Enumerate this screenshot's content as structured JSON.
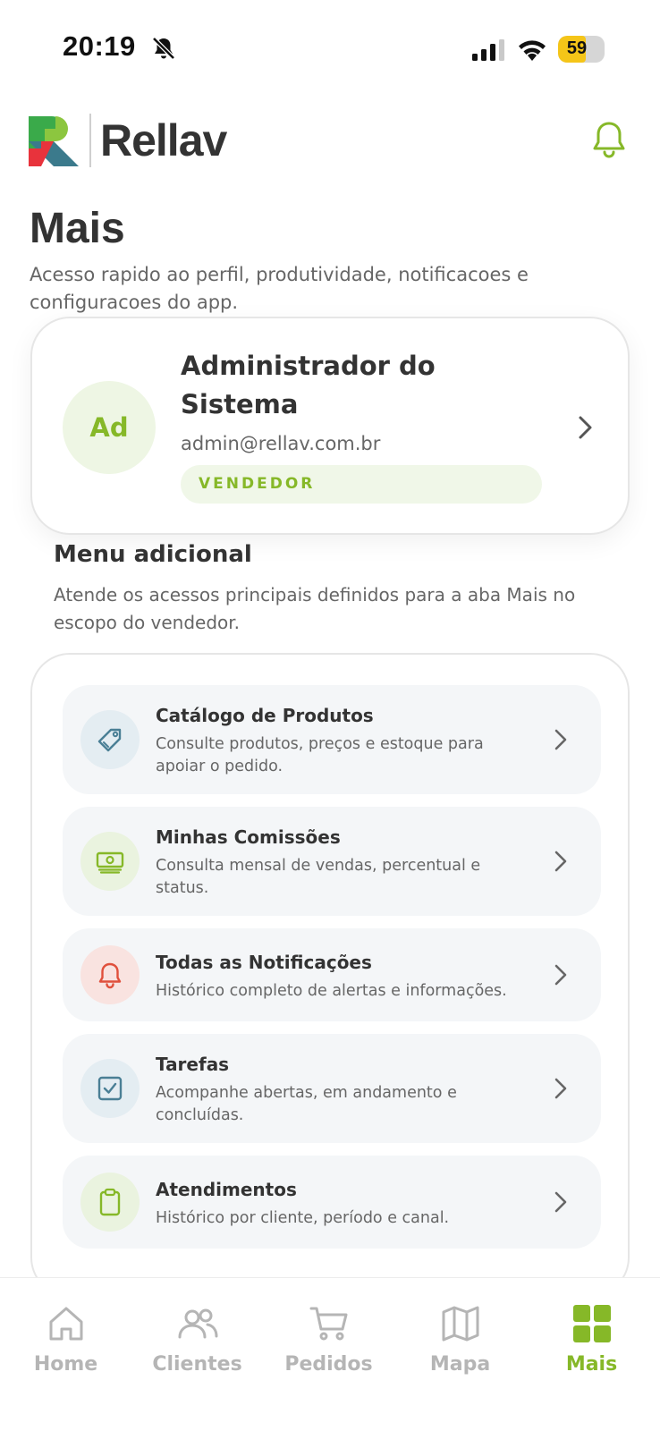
{
  "status_bar": {
    "time": "20:19",
    "battery": "59",
    "battery_level": 0.59
  },
  "header": {
    "brand": "Rellav"
  },
  "page": {
    "title": "Mais",
    "subtitle": "Acesso rapido ao perfil, produtividade, notificacoes e configuracoes do app."
  },
  "profile": {
    "initials": "Ad",
    "name": "Administrador do Sistema",
    "email": "admin@rellav.com.br",
    "role": "VENDEDOR"
  },
  "section": {
    "title": "Menu adicional",
    "subtitle": "Atende os acessos principais definidos para a aba Mais no escopo do vendedor."
  },
  "menu": [
    {
      "title": "Catálogo de Produtos",
      "desc": "Consulte produtos, preços e estoque para apoiar o pedido.",
      "icon": "tag-icon",
      "color": "#4a7f95"
    },
    {
      "title": "Minhas Comissões",
      "desc": "Consulta mensal de vendas, percentual e status.",
      "icon": "money-icon",
      "color": "#86b828"
    },
    {
      "title": "Todas as Notificações",
      "desc": "Histórico completo de alertas e informações.",
      "icon": "bell-icon",
      "color": "#e0503c"
    },
    {
      "title": "Tarefas",
      "desc": "Acompanhe abertas, em andamento e concluídas.",
      "icon": "checkbox-icon",
      "color": "#4a7f95"
    },
    {
      "title": "Atendimentos",
      "desc": "Histórico por cliente, período e canal.",
      "icon": "clipboard-icon",
      "color": "#86b828"
    }
  ],
  "tabs": [
    {
      "label": "Home",
      "icon": "home-icon"
    },
    {
      "label": "Clientes",
      "icon": "users-icon"
    },
    {
      "label": "Pedidos",
      "icon": "cart-icon"
    },
    {
      "label": "Mapa",
      "icon": "map-icon"
    },
    {
      "label": "Mais",
      "icon": "grid-icon",
      "active": true
    }
  ],
  "colors": {
    "accent": "#86b828",
    "text": "#333333",
    "muted": "#666666"
  }
}
